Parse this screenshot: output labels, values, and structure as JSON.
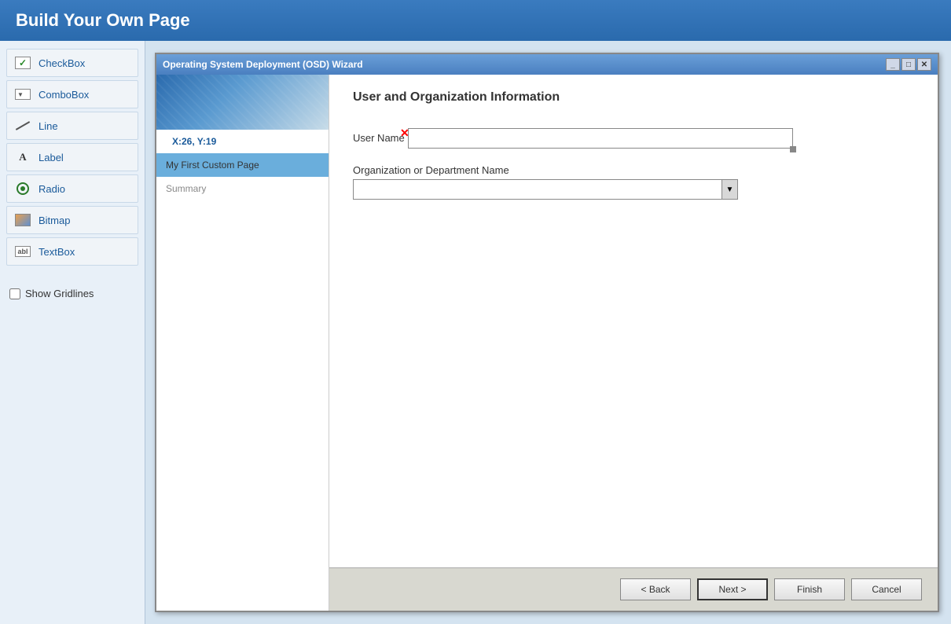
{
  "page": {
    "title": "Build Your Own Page"
  },
  "toolbox": {
    "items": [
      {
        "id": "checkbox",
        "label": "CheckBox",
        "icon": "checkbox-icon"
      },
      {
        "id": "combobox",
        "label": "ComboBox",
        "icon": "combobox-icon"
      },
      {
        "id": "line",
        "label": "Line",
        "icon": "line-icon"
      },
      {
        "id": "label",
        "label": "Label",
        "icon": "label-icon"
      },
      {
        "id": "radio",
        "label": "Radio",
        "icon": "radio-icon"
      },
      {
        "id": "bitmap",
        "label": "Bitmap",
        "icon": "bitmap-icon"
      },
      {
        "id": "textbox",
        "label": "TextBox",
        "icon": "textbox-icon"
      }
    ],
    "show_gridlines_label": "Show Gridlines"
  },
  "wizard": {
    "title": "Operating System Deployment (OSD) Wizard",
    "coords": "X:26, Y:19",
    "nav_items": [
      {
        "id": "custom-page",
        "label": "My First Custom Page",
        "active": true
      },
      {
        "id": "summary",
        "label": "Summary",
        "active": false
      }
    ],
    "form_title": "User and Organization Information",
    "fields": [
      {
        "id": "username",
        "label": "User Name",
        "type": "text"
      },
      {
        "id": "orgname",
        "label": "Organization or Department Name",
        "type": "combo"
      }
    ],
    "buttons": {
      "back": "< Back",
      "next": "Next >",
      "finish": "Finish",
      "cancel": "Cancel"
    }
  }
}
